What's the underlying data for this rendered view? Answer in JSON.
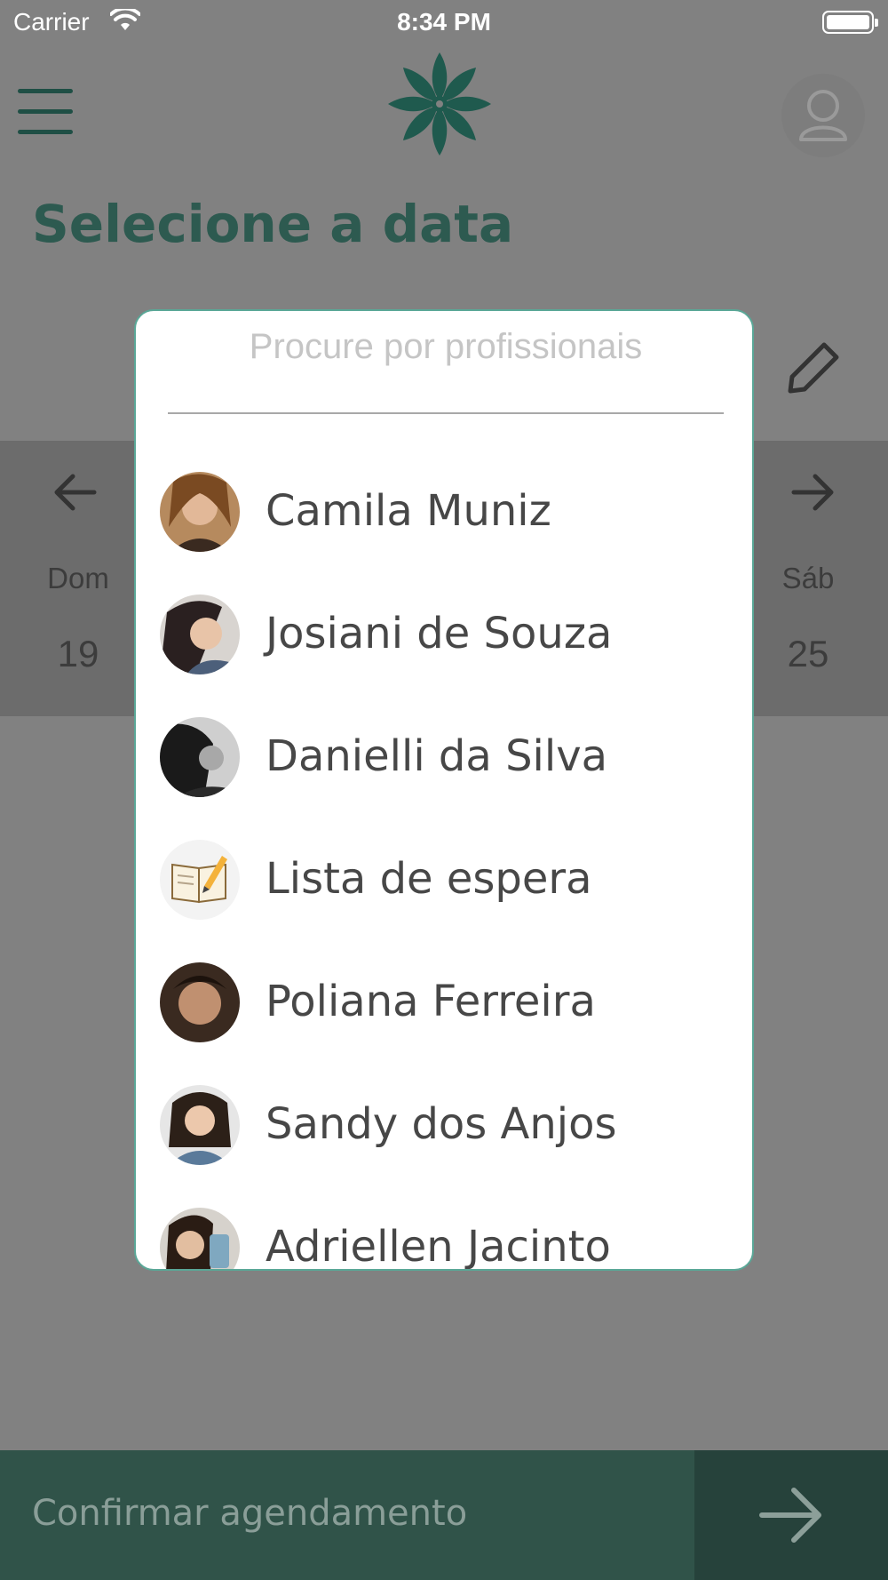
{
  "status_bar": {
    "carrier": "Carrier",
    "time": "8:34 PM"
  },
  "header": {
    "menu_icon": "hamburger-menu-icon",
    "logo_icon": "flower-logo-icon",
    "profile_icon": "user-profile-icon",
    "brand_color": "#1f5a4e"
  },
  "page": {
    "title": "Selecione a data"
  },
  "calendar": {
    "prev_icon": "arrow-left-icon",
    "next_icon": "arrow-right-icon",
    "edit_icon": "pencil-icon",
    "days": [
      {
        "name": "Dom",
        "number": "19"
      },
      {
        "name": "Sáb",
        "number": "25"
      }
    ]
  },
  "modal": {
    "search_placeholder": "Procure por profissionais",
    "accent_color": "#5aa797",
    "professionals": [
      {
        "name": "Camila Muniz",
        "avatar": "photo-avatar"
      },
      {
        "name": "Josiani de Souza",
        "avatar": "photo-avatar"
      },
      {
        "name": "Danielli da Silva",
        "avatar": "photo-avatar"
      },
      {
        "name": "Lista de espera",
        "avatar": "notebook-pencil-icon"
      },
      {
        "name": "Poliana Ferreira",
        "avatar": "photo-avatar"
      },
      {
        "name": "Sandy dos Anjos",
        "avatar": "photo-avatar"
      },
      {
        "name": "Adriellen Jacinto",
        "avatar": "photo-avatar"
      }
    ]
  },
  "footer": {
    "confirm_label": "Confirmar agendamento",
    "confirm_icon": "arrow-right-icon"
  }
}
